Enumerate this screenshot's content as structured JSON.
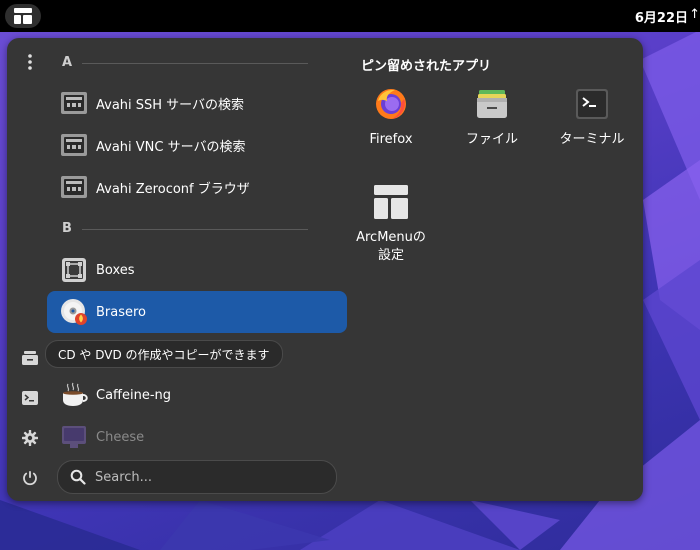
{
  "topbar": {
    "clock": "6月22日",
    "edge_glyph": "↑"
  },
  "sections": [
    {
      "letter": "A"
    },
    {
      "letter": "B"
    }
  ],
  "apps": [
    {
      "label": "Avahi SSH サーバの検索",
      "icon": "network-server-icon"
    },
    {
      "label": "Avahi VNC サーバの検索",
      "icon": "network-server-icon"
    },
    {
      "label": "Avahi Zeroconf ブラウザ",
      "icon": "network-server-icon"
    },
    {
      "label": "Boxes",
      "icon": "boxes-icon"
    },
    {
      "label": "Brasero",
      "icon": "disc-burner-icon",
      "selected": true
    },
    {
      "label": "Caffeine-ng",
      "icon": "coffee-cup-icon"
    },
    {
      "label": "Cheese",
      "icon": "webcam-icon",
      "faded": true
    }
  ],
  "tooltip": "CD や DVD の作成やコピーができます",
  "search": {
    "placeholder": "Search..."
  },
  "pinned": {
    "title": "ピン留めされたアプリ",
    "items": [
      {
        "label": "Firefox",
        "icon": "firefox-icon"
      },
      {
        "label": "ファイル",
        "icon": "files-icon"
      },
      {
        "label": "ターミナル",
        "icon": "terminal-icon"
      },
      {
        "label": "ArcMenuの",
        "label2": "設定",
        "icon": "arcmenu-settings-icon"
      }
    ]
  },
  "sidebar": [
    "more-options-icon",
    "files-icon",
    "terminal-icon",
    "gear-icon",
    "power-icon"
  ],
  "colors": {
    "menu_bg": "#363636",
    "selected_bg": "#1d5aa8",
    "topbar_bg": "#000000",
    "wallpaper_accent": "#6d4fd6"
  }
}
